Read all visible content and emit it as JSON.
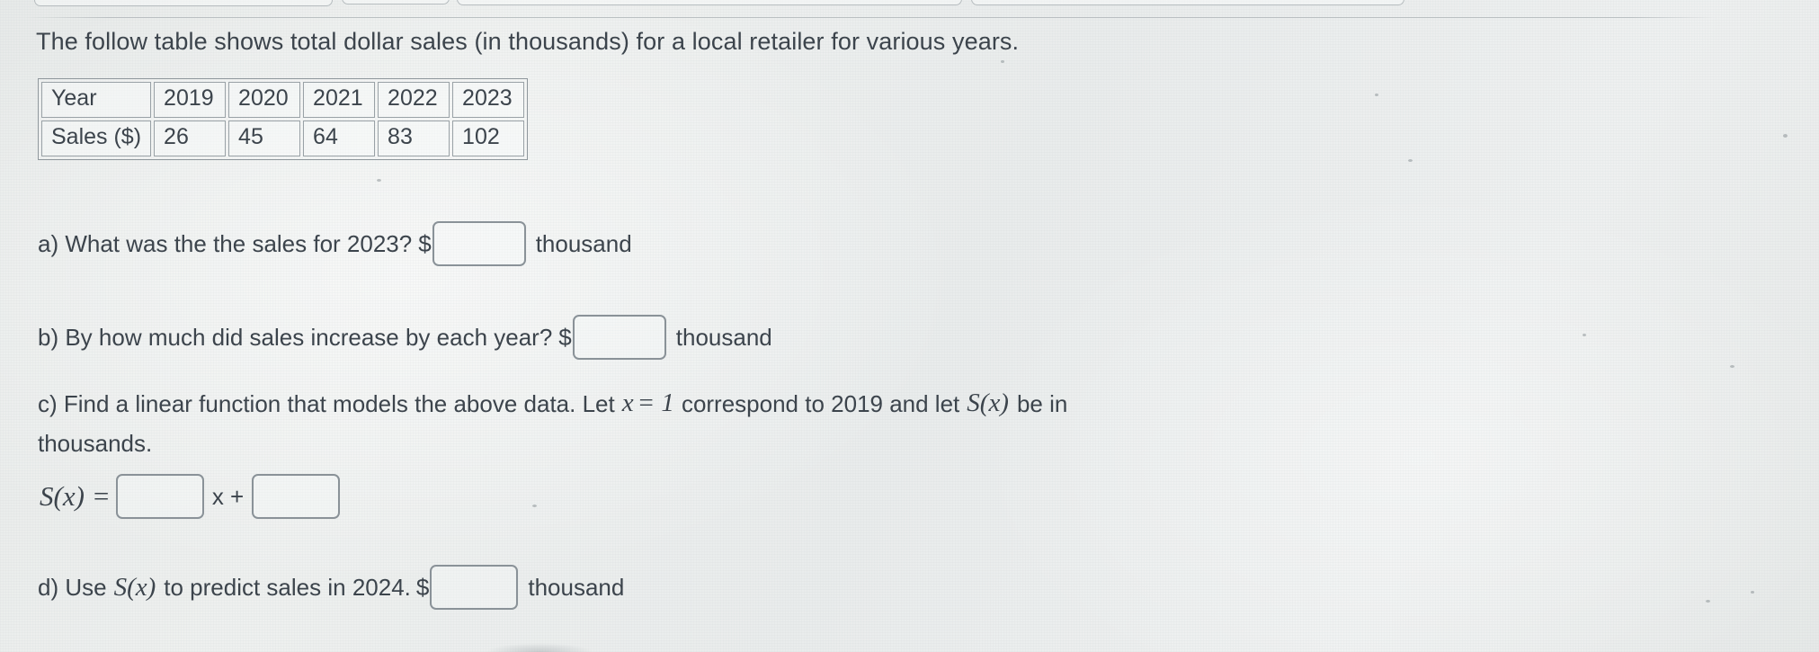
{
  "prompt": "The follow table shows total dollar sales (in thousands) for a local retailer for various years.",
  "table": {
    "row_labels": [
      "Year",
      "Sales ($)"
    ],
    "years": [
      "2019",
      "2020",
      "2021",
      "2022",
      "2023"
    ],
    "sales": [
      "26",
      "45",
      "64",
      "83",
      "102"
    ]
  },
  "questions": {
    "a": {
      "text": "a) What was the the sales for 2023?",
      "dollar": "$",
      "answer_value": "",
      "unit": "thousand"
    },
    "b": {
      "text": "b) By how much did sales increase by each year?",
      "dollar": "$",
      "answer_value": "",
      "unit": "thousand"
    },
    "c": {
      "text_part1": "c) Find a linear function that models the above data. Let",
      "math_x": "x",
      "equals_one": "= 1",
      "text_part2": "correspond to 2019 and let",
      "math_sx": "S(x)",
      "text_part3": "be in",
      "text_line2": "thousands.",
      "formula_lhs": "S(x)",
      "formula_equals": "=",
      "slope_value": "",
      "x_plus": "x +",
      "intercept_value": ""
    },
    "d": {
      "text_part1": "d) Use",
      "math_sx": "S(x)",
      "text_part2": "to predict sales in 2024.",
      "dollar": "$",
      "answer_value": "",
      "unit": "thousand"
    }
  },
  "colors": {
    "background": "#eceeed",
    "text": "#3c444c",
    "box_border": "#8a9298",
    "table_border": "#99a1a6"
  }
}
